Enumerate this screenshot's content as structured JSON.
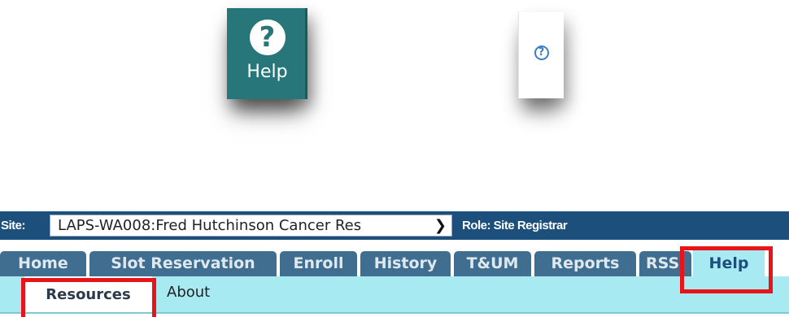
{
  "help_large": {
    "icon": "question-circle-icon",
    "label": "Help",
    "bg_color": "#27767a"
  },
  "help_small": {
    "icon": "question-circle-outline-icon",
    "icon_color": "#3b7fc4"
  },
  "app_nav": {
    "site_label": "Site:",
    "site_selected": "LAPS-WA008:Fred Hutchinson Cancer Res",
    "role_label": "Role: Site Registrar",
    "tabs": [
      {
        "label": "Home"
      },
      {
        "label": "Slot Reservation"
      },
      {
        "label": "Enroll"
      },
      {
        "label": "History"
      },
      {
        "label": "T&UM"
      },
      {
        "label": "Reports"
      },
      {
        "label": "RSS"
      },
      {
        "label": "Help",
        "active": true
      }
    ],
    "subtabs": [
      {
        "label": "Resources",
        "selected": true
      },
      {
        "label": "About"
      }
    ],
    "colors": {
      "header": "#1c4f7b",
      "tab": "#3f6e90",
      "active_tab": "#a8eaf2",
      "highlight": "#e8141a"
    }
  }
}
